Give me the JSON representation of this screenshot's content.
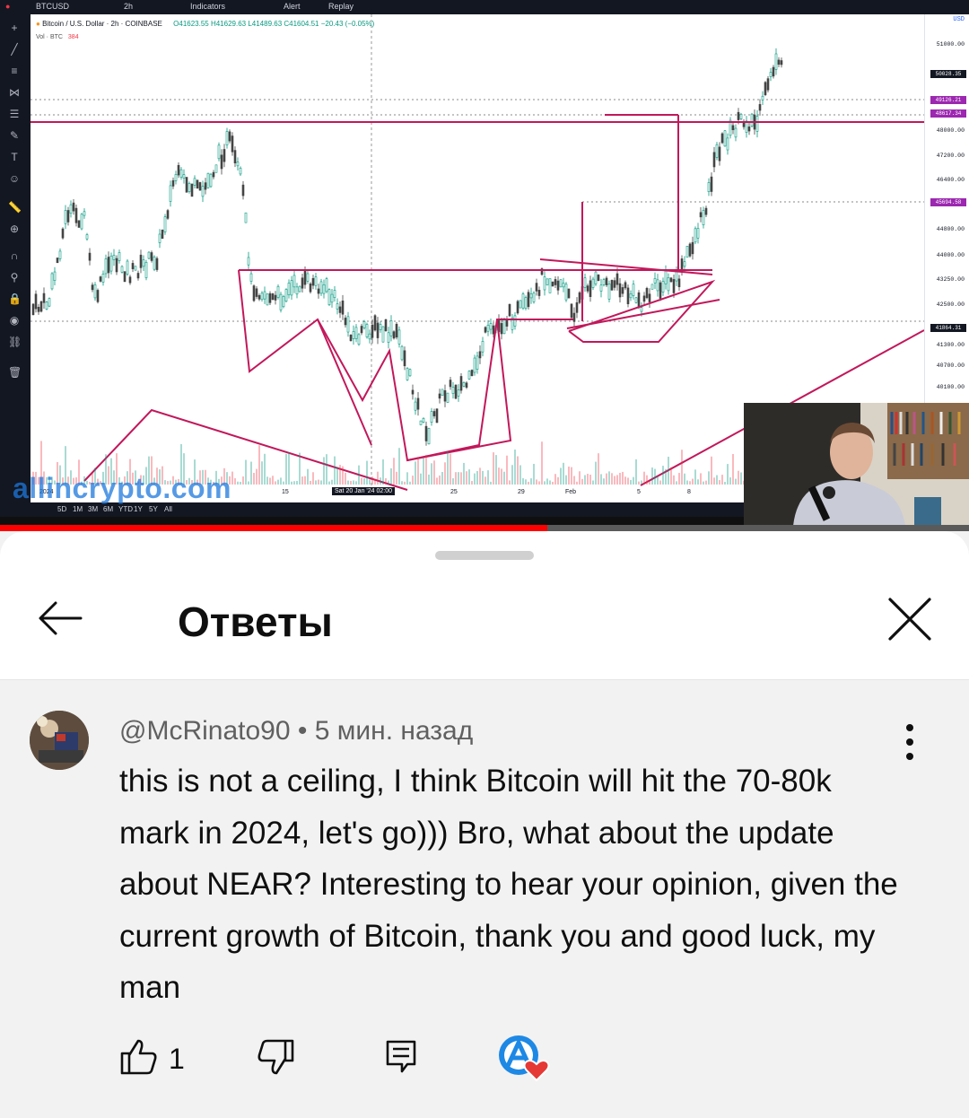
{
  "video": {
    "tradingview": {
      "symbol": "BTCUSD",
      "interval": "2h",
      "indicators_label": "Indicators",
      "alert_label": "Alert",
      "replay_label": "Replay",
      "title": "Bitcoin / U.S. Dollar · 2h · COINBASE",
      "ohlc": "O41623.55 H41629.63 L41489.63 C41604.51 −20.43 (−0.05%)",
      "volume_label": "Vol · BTC",
      "volume_value": "384",
      "currency": "USD",
      "price_axis_labels": [
        "51000.00",
        "48000.00",
        "47200.00",
        "46400.00",
        "44800.00",
        "44000.00",
        "43250.00",
        "42500.00",
        "41300.00",
        "40700.00",
        "40100.00"
      ],
      "price_tags": [
        {
          "text": "50028.35",
          "color": "#131722"
        },
        {
          "text": "49126.21",
          "color": "#9c27b0"
        },
        {
          "text": "48617.34",
          "color": "#9c27b0"
        },
        {
          "text": "45694.58",
          "color": "#9c27b0"
        },
        {
          "text": "41864.31",
          "color": "#131722"
        }
      ],
      "time_labels": [
        "2024",
        "15",
        "25",
        "29",
        "Feb",
        "5",
        "8"
      ],
      "crosshair_time": "Sat 20 Jan '24  02:00",
      "timeframes": [
        "5D",
        "1M",
        "3M",
        "6M",
        "YTD",
        "1Y",
        "5Y",
        "All"
      ]
    },
    "watermark": "allincrypto.com",
    "progress_fraction": 0.565
  },
  "sheet": {
    "title": "Ответы"
  },
  "comment": {
    "author": "@McRinato90",
    "separator": " • ",
    "time": "5 мин. назад",
    "text": "this is not a ceiling, I think Bitcoin will hit the 70-80k mark in 2024, let's go))) Bro, what about the update about NEAR?  Interesting to hear your opinion, given the current growth of Bitcoin, thank you and good luck, my man",
    "likes": "1"
  },
  "colors": {
    "accent_red": "#ff0000",
    "drawing_magenta": "#c2185b",
    "heart_red": "#e53935",
    "channel_blue": "#1e88e5"
  }
}
